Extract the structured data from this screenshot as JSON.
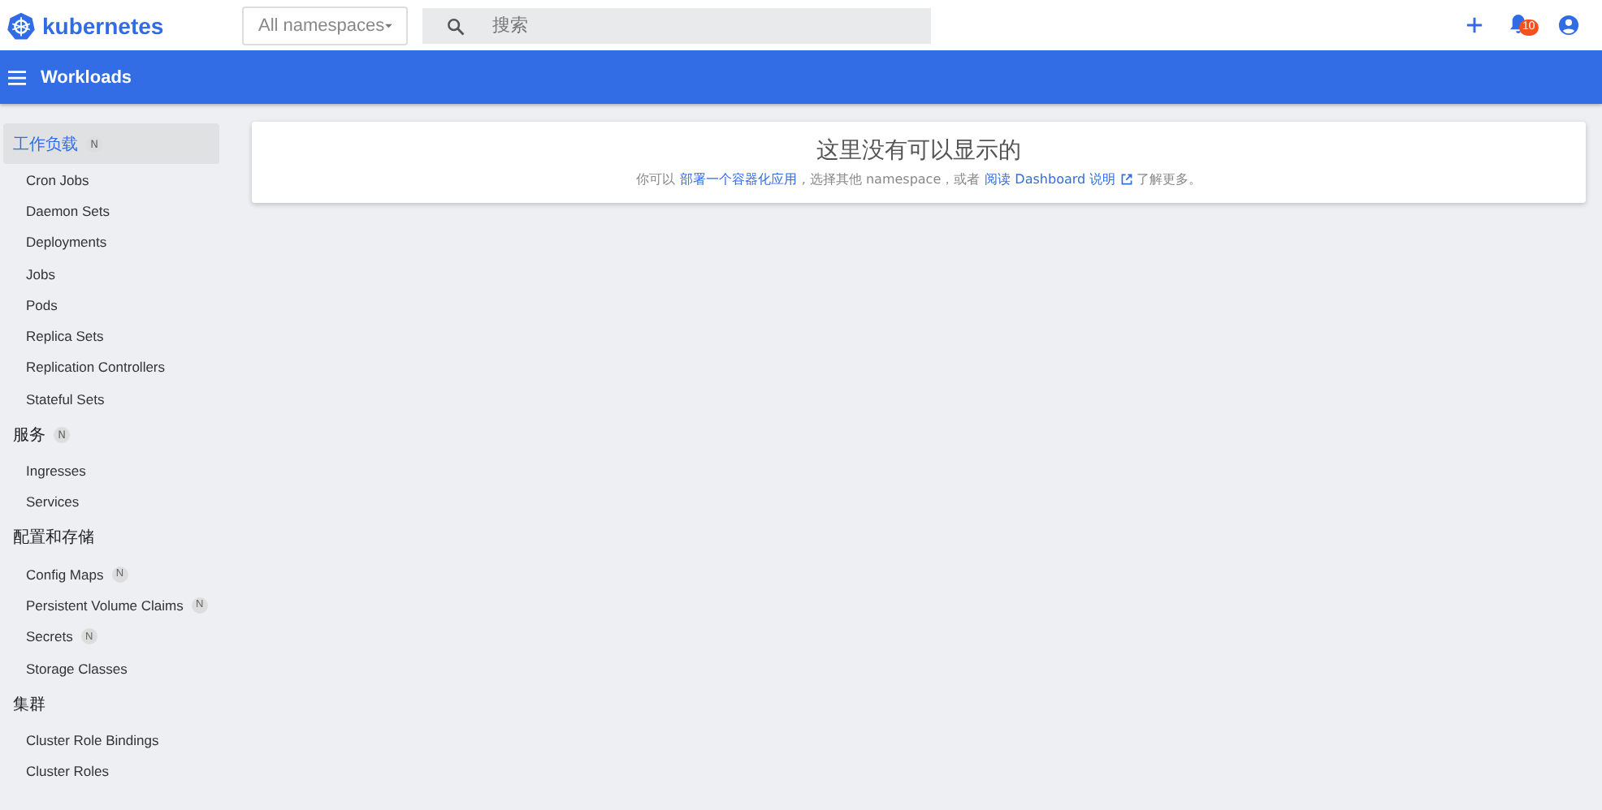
{
  "header": {
    "logo_text": "kubernetes",
    "namespace_select": "All namespaces",
    "search": {
      "placeholder": "搜索"
    },
    "notification_count": "10"
  },
  "toolbar": {
    "title": "Workloads"
  },
  "sidebar": [
    {
      "title": "工作负载",
      "badge": "N",
      "selected": true,
      "items": [
        {
          "label": "Cron Jobs"
        },
        {
          "label": "Daemon Sets"
        },
        {
          "label": "Deployments"
        },
        {
          "label": "Jobs"
        },
        {
          "label": "Pods"
        },
        {
          "label": "Replica Sets"
        },
        {
          "label": "Replication Controllers"
        },
        {
          "label": "Stateful Sets"
        }
      ]
    },
    {
      "title": "服务",
      "badge": "N",
      "selected": false,
      "items": [
        {
          "label": "Ingresses"
        },
        {
          "label": "Services"
        }
      ]
    },
    {
      "title": "配置和存储",
      "selected": false,
      "items": [
        {
          "label": "Config Maps",
          "badge": "N"
        },
        {
          "label": "Persistent Volume Claims",
          "badge": "N"
        },
        {
          "label": "Secrets",
          "badge": "N"
        },
        {
          "label": "Storage Classes"
        }
      ]
    },
    {
      "title": "集群",
      "selected": false,
      "items": [
        {
          "label": "Cluster Role Bindings"
        },
        {
          "label": "Cluster Roles"
        }
      ]
    }
  ],
  "empty_state": {
    "title": "这里没有可以显示的",
    "text_before": "你可以",
    "link_deploy": "部署一个容器化应用",
    "text_middle": ", 选择其他 namespace，或者",
    "link_docs": "阅读 Dashboard 说明",
    "text_after": "了解更多。"
  }
}
